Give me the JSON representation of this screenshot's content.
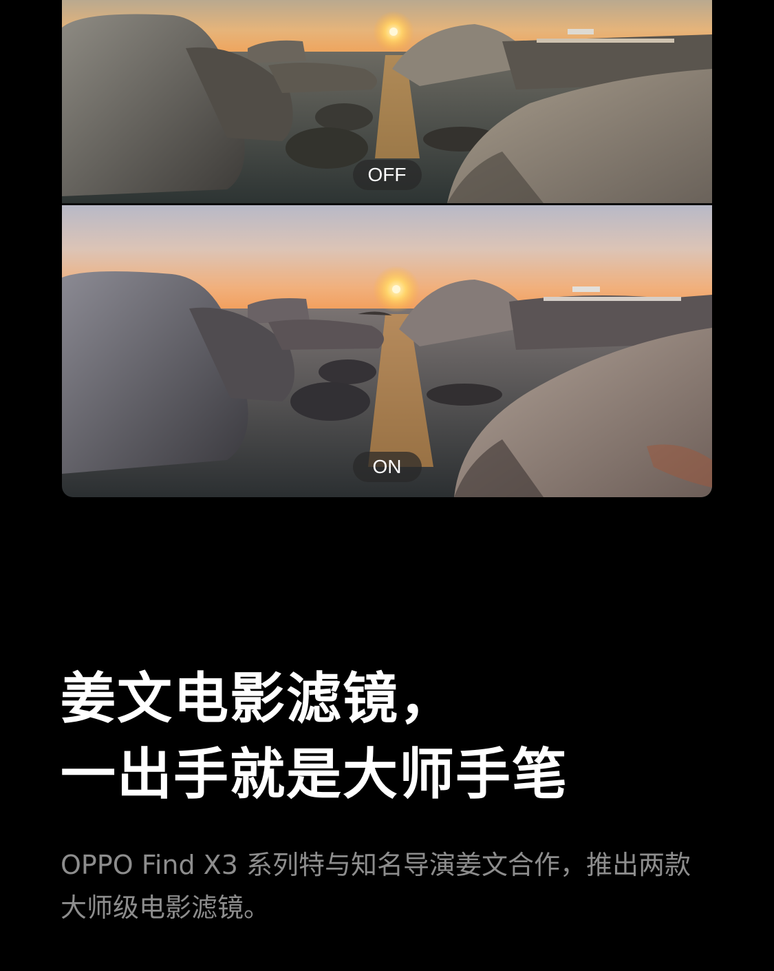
{
  "comparison": {
    "off_label": "OFF",
    "on_label": "ON"
  },
  "headline": {
    "line1": "姜文电影滤镜，",
    "line2": "一出手就是大师手笔"
  },
  "description": "OPPO Find X3 系列特与知名导演姜文合作，推出两款大师级电影滤镜。",
  "colors": {
    "background": "#000000",
    "headline": "#ffffff",
    "description": "#8d8d8d",
    "pill_bg": "rgba(40,40,40,0.72)"
  }
}
